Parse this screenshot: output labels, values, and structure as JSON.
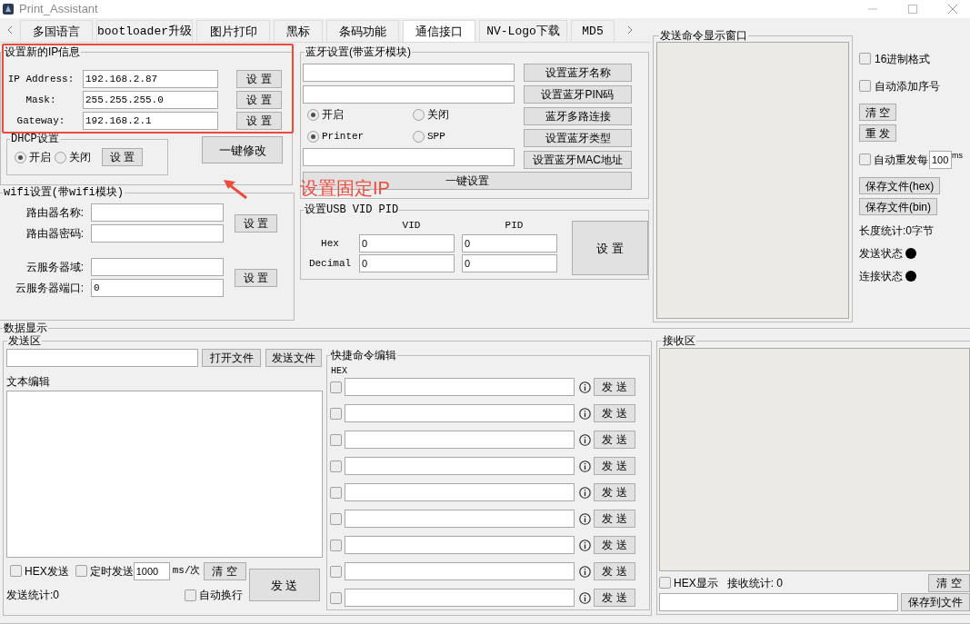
{
  "window": {
    "title": "Print_Assistant"
  },
  "tabs": [
    {
      "label": "多国语言",
      "selected": false
    },
    {
      "label": "bootloader升级",
      "selected": false
    },
    {
      "label": "图片打印",
      "selected": false
    },
    {
      "label": "黑标",
      "selected": false
    },
    {
      "label": "条码功能",
      "selected": false
    },
    {
      "label": "通信接口",
      "selected": true
    },
    {
      "label": "NV-Logo下载",
      "selected": false
    },
    {
      "label": "MD5",
      "selected": false
    }
  ],
  "ip_settings": {
    "title": "设置新的IP信息",
    "fields": [
      {
        "label": "IP Address:",
        "value": "192.168.2.87",
        "button": "设 置"
      },
      {
        "label": "Mask:",
        "value": "255.255.255.0",
        "button": "设 置"
      },
      {
        "label": "Gateway:",
        "value": "192.168.2.1",
        "button": "设 置"
      }
    ]
  },
  "dhcp": {
    "title": "DHCP设置",
    "options": [
      {
        "label": "开启",
        "selected": true
      },
      {
        "label": "关闭",
        "selected": false
      }
    ],
    "button": "设 置"
  },
  "apply_all_button": "一键修改",
  "annotation": {
    "text": "设置固定IP"
  },
  "wifi": {
    "title": "wifi设置(带wifi模块)",
    "groups": [
      {
        "fields": [
          {
            "label": "路由器名称:"
          },
          {
            "label": "路由器密码:"
          }
        ],
        "button": "设 置"
      },
      {
        "fields": [
          {
            "label": "云服务器域:"
          },
          {
            "label": "云服务器端口:",
            "value": "0"
          }
        ],
        "button": "设 置"
      }
    ]
  },
  "bluetooth": {
    "title": "蓝牙设置(带蓝牙模块)",
    "buttons": [
      "设置蓝牙名称",
      "设置蓝牙PIN码",
      "蓝牙多路连接",
      "设置蓝牙类型",
      "设置蓝牙MAC地址"
    ],
    "radio_groups": [
      [
        {
          "label": "开启",
          "selected": true
        },
        {
          "label": "关闭",
          "selected": false
        }
      ],
      [
        {
          "label": "Printer",
          "selected": true
        },
        {
          "label": "SPP",
          "selected": false
        }
      ]
    ],
    "apply_button": "一键设置"
  },
  "usb": {
    "title": "设置USB VID PID",
    "columns": [
      "VID",
      "PID"
    ],
    "rows": [
      {
        "label": "Hex",
        "values": [
          "0",
          "0"
        ]
      },
      {
        "label": "Decimal",
        "values": [
          "0",
          "0"
        ]
      }
    ],
    "button": "设 置"
  },
  "send_display": {
    "title": "发送命令显示窗口",
    "options": [
      {
        "kind": "checkbox",
        "label": "16进制格式",
        "checked": false
      },
      {
        "kind": "checkbox",
        "label": "自动添加序号",
        "checked": false
      },
      {
        "kind": "button",
        "label": "清 空"
      },
      {
        "kind": "button",
        "label": "重 发"
      },
      {
        "kind": "repeat",
        "label": "自动重发每",
        "checked": false,
        "value": "100",
        "unit": "ms"
      },
      {
        "kind": "button",
        "label": "保存文件(hex)"
      },
      {
        "kind": "button",
        "label": "保存文件(bin)"
      },
      {
        "kind": "text",
        "label": "长度统计:0字节"
      },
      {
        "kind": "status",
        "label": "发送状态"
      },
      {
        "kind": "status",
        "label": "连接状态"
      }
    ]
  },
  "data_display": {
    "title": "数据显示",
    "send_area": {
      "title": "发送区",
      "file_buttons": [
        "打开文件",
        "发送文件"
      ],
      "text_label": "文本编辑",
      "hex_send": {
        "label": "HEX发送",
        "checked": false
      },
      "timed_send": {
        "label": "定时发送",
        "checked": false,
        "value": "1000",
        "unit": "ms/次"
      },
      "clear_button": "清 空",
      "send_button": "发 送",
      "stats": "发送统计:0",
      "auto_wrap": {
        "label": "自动换行",
        "checked": false
      }
    },
    "quick_commands": {
      "title": "快捷命令编辑",
      "hex_label": "HEX",
      "rows": [
        {
          "checked": false,
          "button": "发 送"
        },
        {
          "checked": false,
          "button": "发 送"
        },
        {
          "checked": false,
          "button": "发 送"
        },
        {
          "checked": false,
          "button": "发 送"
        },
        {
          "checked": false,
          "button": "发 送"
        },
        {
          "checked": false,
          "button": "发 送"
        },
        {
          "checked": false,
          "button": "发 送"
        },
        {
          "checked": false,
          "button": "发 送"
        },
        {
          "checked": false,
          "button": "发 送"
        }
      ]
    },
    "receive_area": {
      "title": "接收区",
      "hex_display": {
        "label": "HEX显示",
        "checked": false
      },
      "stats": "接收统计: 0",
      "clear_button": "清 空",
      "save_button": "保存到文件"
    }
  }
}
